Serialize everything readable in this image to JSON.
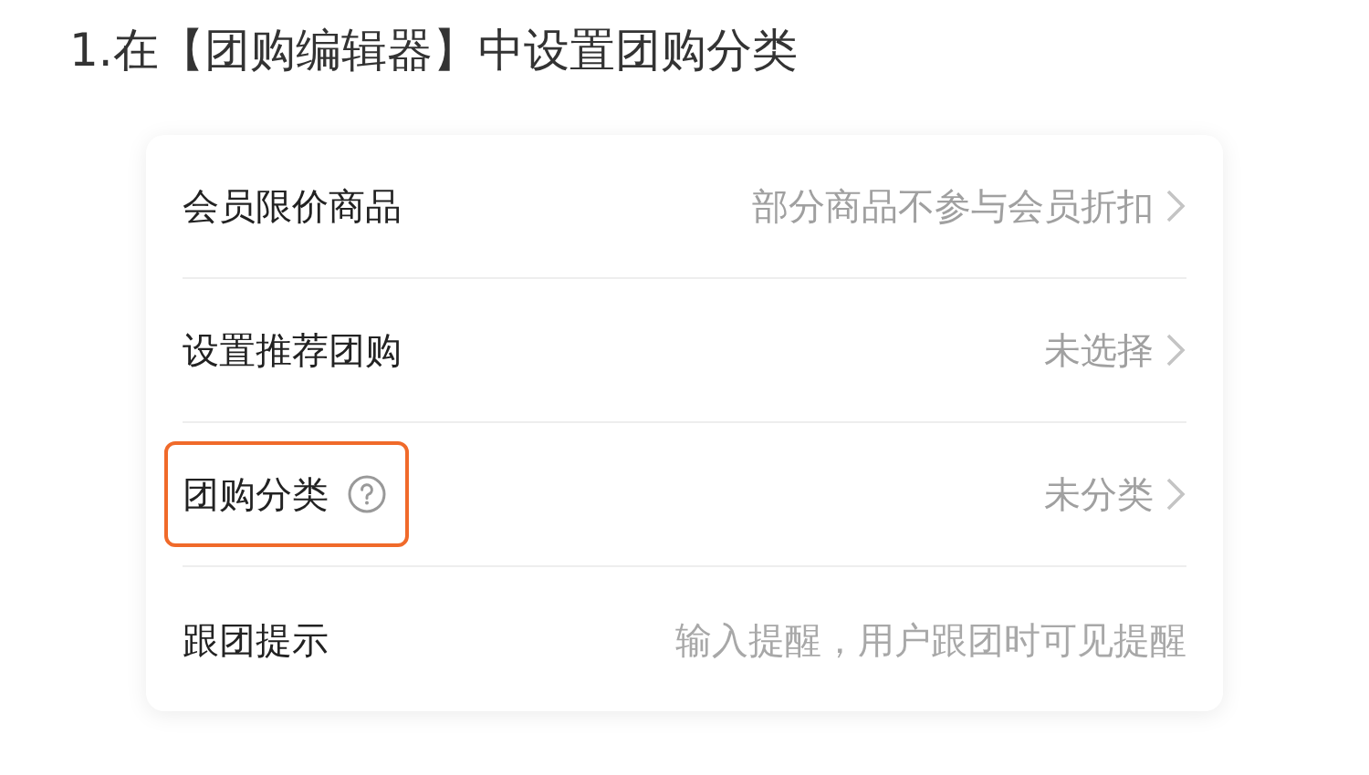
{
  "heading": "1.在【团购编辑器】中设置团购分类",
  "rows": [
    {
      "kind": "link",
      "label": "会员限价商品",
      "value": "部分商品不参与会员折扣",
      "help": false,
      "highlighted": false
    },
    {
      "kind": "link",
      "label": "设置推荐团购",
      "value": "未选择",
      "help": false,
      "highlighted": false
    },
    {
      "kind": "link",
      "label": "团购分类",
      "value": "未分类",
      "help": true,
      "highlighted": true
    },
    {
      "kind": "input",
      "label": "跟团提示",
      "placeholder": "输入提醒，用户跟团时可见提醒",
      "help": false,
      "highlighted": false
    }
  ]
}
